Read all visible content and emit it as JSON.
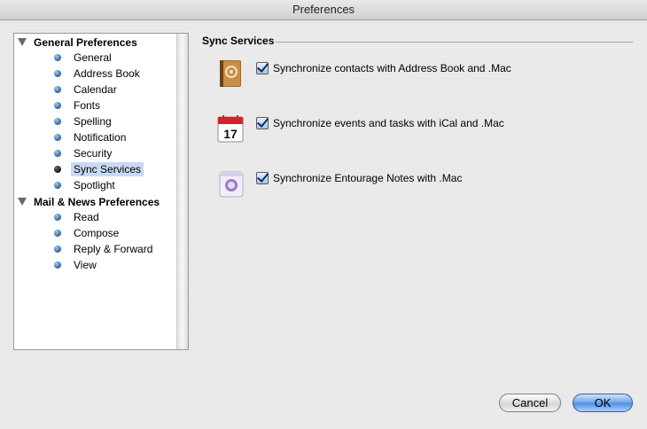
{
  "window": {
    "title": "Preferences"
  },
  "sidebar": {
    "groups": [
      {
        "label": "General Preferences",
        "items": [
          "General",
          "Address Book",
          "Calendar",
          "Fonts",
          "Spelling",
          "Notification",
          "Security",
          "Sync Services",
          "Spotlight"
        ]
      },
      {
        "label": "Mail & News Preferences",
        "items": [
          "Read",
          "Compose",
          "Reply & Forward",
          "View"
        ]
      }
    ],
    "selected": "Sync Services"
  },
  "panel": {
    "title": "Sync Services",
    "options": [
      {
        "icon": "address-book-icon",
        "label": "Synchronize contacts with Address Book and .Mac",
        "checked": true
      },
      {
        "icon": "ical-calendar-icon",
        "label": "Synchronize events and tasks with iCal and .Mac",
        "checked": true
      },
      {
        "icon": "entourage-notes-icon",
        "label": "Synchronize Entourage Notes with .Mac",
        "checked": true
      }
    ]
  },
  "buttons": {
    "cancel": "Cancel",
    "ok": "OK"
  },
  "calendar_icon_day": "17"
}
